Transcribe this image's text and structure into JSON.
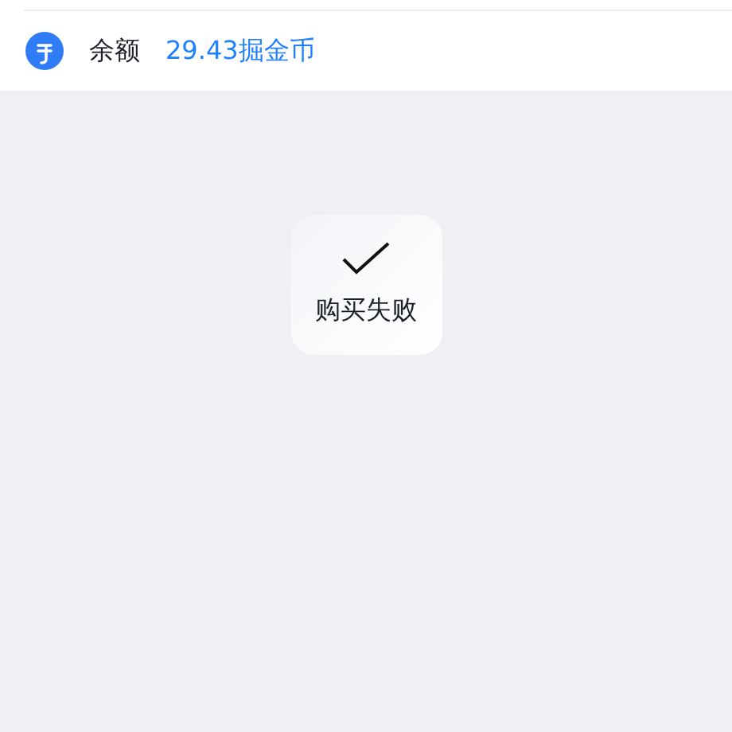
{
  "balance": {
    "label": "余额",
    "value": "29.43掘金币"
  },
  "toast": {
    "message": "购买失败"
  }
}
